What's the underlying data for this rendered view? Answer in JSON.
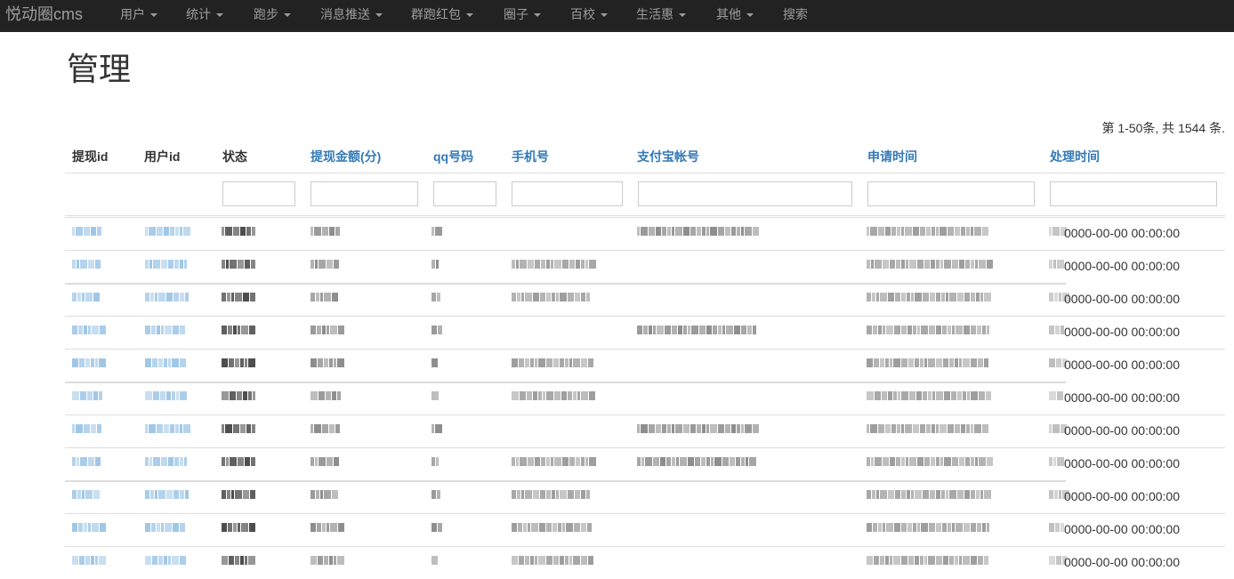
{
  "navbar": {
    "brand": "悦动圈cms",
    "items": [
      {
        "label": "用户",
        "dropdown": true
      },
      {
        "label": "统计",
        "dropdown": true
      },
      {
        "label": "跑步",
        "dropdown": true
      },
      {
        "label": "消息推送",
        "dropdown": true
      },
      {
        "label": "群跑红包",
        "dropdown": true
      },
      {
        "label": "圈子",
        "dropdown": true
      },
      {
        "label": "百校",
        "dropdown": true
      },
      {
        "label": "生活惠",
        "dropdown": true
      },
      {
        "label": "其他",
        "dropdown": true
      },
      {
        "label": "搜索",
        "dropdown": false
      }
    ]
  },
  "page": {
    "title": "管理"
  },
  "summary": {
    "prefix": "第",
    "range": "1-50",
    "mid": "条, 共",
    "total": "1544",
    "suffix": "条."
  },
  "table": {
    "columns": [
      {
        "label": "提现id",
        "sortable": false
      },
      {
        "label": "用户id",
        "sortable": false
      },
      {
        "label": "状态",
        "sortable": false
      },
      {
        "label": "提现金额(分)",
        "sortable": true
      },
      {
        "label": "qq号码",
        "sortable": true
      },
      {
        "label": "手机号",
        "sortable": true
      },
      {
        "label": "支付宝帐号",
        "sortable": true
      },
      {
        "label": "申请时间",
        "sortable": true
      },
      {
        "label": "处理时间",
        "sortable": true
      }
    ],
    "rows": [
      {
        "processed_time": "0000-00-00 00:00:00"
      },
      {
        "processed_time": "0000-00-00 00:00:00"
      },
      {
        "processed_time": "0000-00-00 00:00:00"
      },
      {
        "processed_time": "0000-00-00 00:00:00"
      },
      {
        "processed_time": "0000-00-00 00:00:00"
      },
      {
        "processed_time": "0000-00-00 00:00:00"
      },
      {
        "processed_time": "0000-00-00 00:00:00"
      },
      {
        "processed_time": "0000-00-00 00:00:00"
      },
      {
        "processed_time": "0000-00-00 00:00:00"
      },
      {
        "processed_time": "0000-00-00 00:00:00"
      },
      {
        "processed_time": "0000-00-00 00:00:00"
      }
    ]
  },
  "colors": {
    "navbar_bg": "#222222",
    "nav_text": "#9d9d9d",
    "link": "#337ab7",
    "border": "#dddddd"
  }
}
